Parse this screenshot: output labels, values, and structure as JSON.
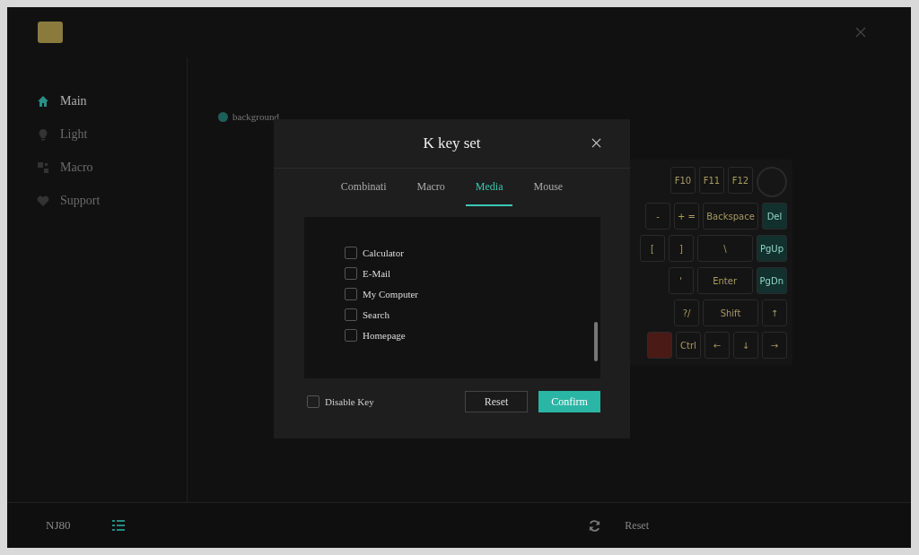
{
  "sidebar": {
    "items": [
      {
        "label": "Main",
        "selected": true
      },
      {
        "label": "Light",
        "selected": false
      },
      {
        "label": "Macro",
        "selected": false
      },
      {
        "label": "Support",
        "selected": false
      }
    ]
  },
  "legend": {
    "label": "background"
  },
  "keyboard": {
    "rows": [
      [
        {
          "label": "F10",
          "kind": "normal"
        },
        {
          "label": "F11",
          "kind": "normal"
        },
        {
          "label": "F12",
          "kind": "normal"
        },
        {
          "kind": "knob"
        }
      ],
      [
        {
          "label": "-",
          "kind": "normal"
        },
        {
          "label": "+ =",
          "kind": "normal"
        },
        {
          "label": "Backspace",
          "kind": "wide"
        },
        {
          "label": "Del",
          "kind": "accent"
        }
      ],
      [
        {
          "label": "[",
          "kind": "normal"
        },
        {
          "label": "]",
          "kind": "normal"
        },
        {
          "label": "\\",
          "kind": "wide"
        },
        {
          "label": "PgUp",
          "kind": "accent"
        }
      ],
      [
        {
          "label": "'",
          "kind": "normal"
        },
        {
          "label": "Enter",
          "kind": "wide"
        },
        {
          "label": "PgDn",
          "kind": "accent"
        }
      ],
      [
        {
          "label": "?/",
          "kind": "normal"
        },
        {
          "label": "Shift",
          "kind": "wide"
        },
        {
          "label": "↑",
          "kind": "normal"
        }
      ],
      [
        {
          "kind": "alert"
        },
        {
          "label": "Ctrl",
          "kind": "normal"
        },
        {
          "label": "←",
          "kind": "normal"
        },
        {
          "label": "↓",
          "kind": "normal"
        },
        {
          "label": "→",
          "kind": "normal"
        }
      ]
    ]
  },
  "dialog": {
    "title": "K key set",
    "tabs": [
      {
        "label": "Combinati",
        "selected": false
      },
      {
        "label": "Macro",
        "selected": false
      },
      {
        "label": "Media",
        "selected": true
      },
      {
        "label": "Mouse",
        "selected": false
      }
    ],
    "options": [
      {
        "label": "Calculator",
        "checked": false
      },
      {
        "label": "E-Mail",
        "checked": false
      },
      {
        "label": "My Computer",
        "checked": false
      },
      {
        "label": "Search",
        "checked": false
      },
      {
        "label": "Homepage",
        "checked": false
      }
    ],
    "disable_key": {
      "label": "Disable Key",
      "checked": false
    },
    "buttons": {
      "reset": "Reset",
      "confirm": "Confirm"
    }
  },
  "bottom_bar": {
    "device": "NJ80",
    "reset": "Reset"
  }
}
